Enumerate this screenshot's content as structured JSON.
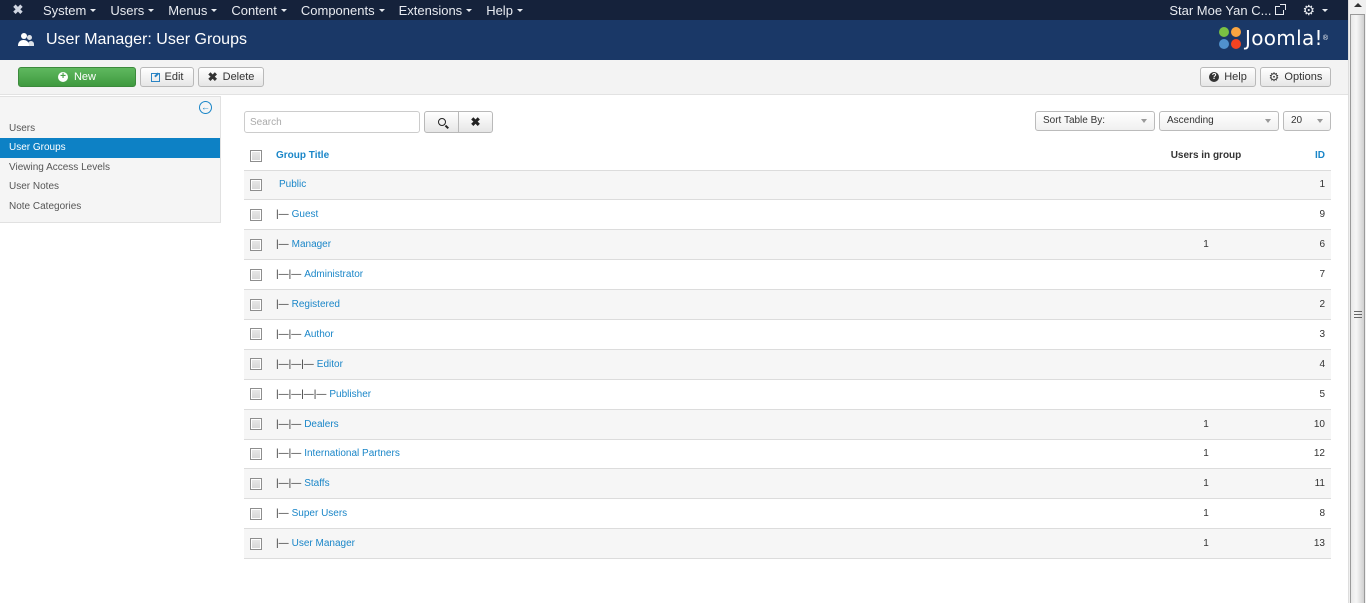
{
  "navbar": {
    "logo_icon": "joomla-icon",
    "menu": [
      {
        "label": "System"
      },
      {
        "label": "Users"
      },
      {
        "label": "Menus"
      },
      {
        "label": "Content"
      },
      {
        "label": "Components"
      },
      {
        "label": "Extensions"
      },
      {
        "label": "Help"
      }
    ],
    "site_name": "Star Moe Yan C...",
    "site_link_icon": "external-link-icon",
    "settings_icon": "gear-icon"
  },
  "header": {
    "title": "User Manager: User Groups",
    "icon": "users-icon",
    "brand": "Joomla!",
    "brand_mark": "®"
  },
  "toolbar": {
    "new_label": "New",
    "edit_label": "Edit",
    "delete_label": "Delete",
    "help_label": "Help",
    "options_label": "Options"
  },
  "sidebar": {
    "collapse_icon": "arrow-left-circle-icon",
    "items": [
      {
        "label": "Users",
        "active": false
      },
      {
        "label": "User Groups",
        "active": true
      },
      {
        "label": "Viewing Access Levels",
        "active": false
      },
      {
        "label": "User Notes",
        "active": false
      },
      {
        "label": "Note Categories",
        "active": false
      }
    ]
  },
  "filters": {
    "search_placeholder": "Search",
    "search_value": "",
    "sort_by": "Sort Table By:",
    "order": "Ascending",
    "limit": "20"
  },
  "table": {
    "headers": {
      "title": "Group Title",
      "users": "Users in group",
      "id": "ID"
    },
    "rows": [
      {
        "prefix": "",
        "title": "Public",
        "users": "",
        "id": "1"
      },
      {
        "prefix": "|—",
        "title": "Guest",
        "users": "",
        "id": "9"
      },
      {
        "prefix": "|—",
        "title": "Manager",
        "users": "1",
        "id": "6"
      },
      {
        "prefix": "|—|—",
        "title": "Administrator",
        "users": "",
        "id": "7"
      },
      {
        "prefix": "|—",
        "title": "Registered",
        "users": "",
        "id": "2"
      },
      {
        "prefix": "|—|—",
        "title": "Author",
        "users": "",
        "id": "3"
      },
      {
        "prefix": "|—|—|—",
        "title": "Editor",
        "users": "",
        "id": "4"
      },
      {
        "prefix": "|—|—|—|—",
        "title": "Publisher",
        "users": "",
        "id": "5"
      },
      {
        "prefix": "|—|—",
        "title": "Dealers",
        "users": "1",
        "id": "10"
      },
      {
        "prefix": "|—|—",
        "title": "International Partners",
        "users": "1",
        "id": "12"
      },
      {
        "prefix": "|—|—",
        "title": "Staffs",
        "users": "1",
        "id": "11"
      },
      {
        "prefix": "|—",
        "title": "Super Users",
        "users": "1",
        "id": "8"
      },
      {
        "prefix": "|—",
        "title": "User Manager",
        "users": "1",
        "id": "13"
      }
    ]
  }
}
